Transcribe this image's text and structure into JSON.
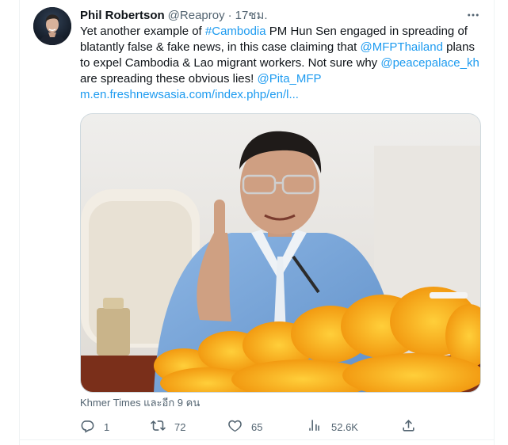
{
  "author": {
    "display_name": "Phil Robertson",
    "handle": "@Reaproy",
    "separator": "·",
    "timestamp": "17ชม."
  },
  "tweet": {
    "text_1": "Yet another example of ",
    "hashtag": "#Cambodia",
    "text_2": " PM Hun Sen engaged in spreading of blatantly false & fake news, in this case claiming that ",
    "mention_1": "@MFPThailand",
    "text_3": " plans to expel Cambodia & Lao migrant workers. Not sure why ",
    "mention_2": "@peacepalace_kh",
    "text_4": " are spreading these obvious lies! ",
    "mention_3": "@Pita_MFP",
    "url": "m.en.freshnewsasia.com/index.php/en/l..."
  },
  "media": {
    "tagged_text": "Khmer Times และอีก 9 คน"
  },
  "actions": {
    "replies": "1",
    "retweets": "72",
    "likes": "65",
    "views": "52.6K"
  },
  "icons": {
    "more": "more-horizontal-icon",
    "reply": "reply-icon",
    "retweet": "retweet-icon",
    "like": "heart-icon",
    "views": "views-chart-icon",
    "share": "share-icon"
  },
  "colors": {
    "link": "#1d9bf0",
    "secondary_text": "#536471",
    "primary_text": "#0f1419",
    "border": "#cfd9de"
  }
}
